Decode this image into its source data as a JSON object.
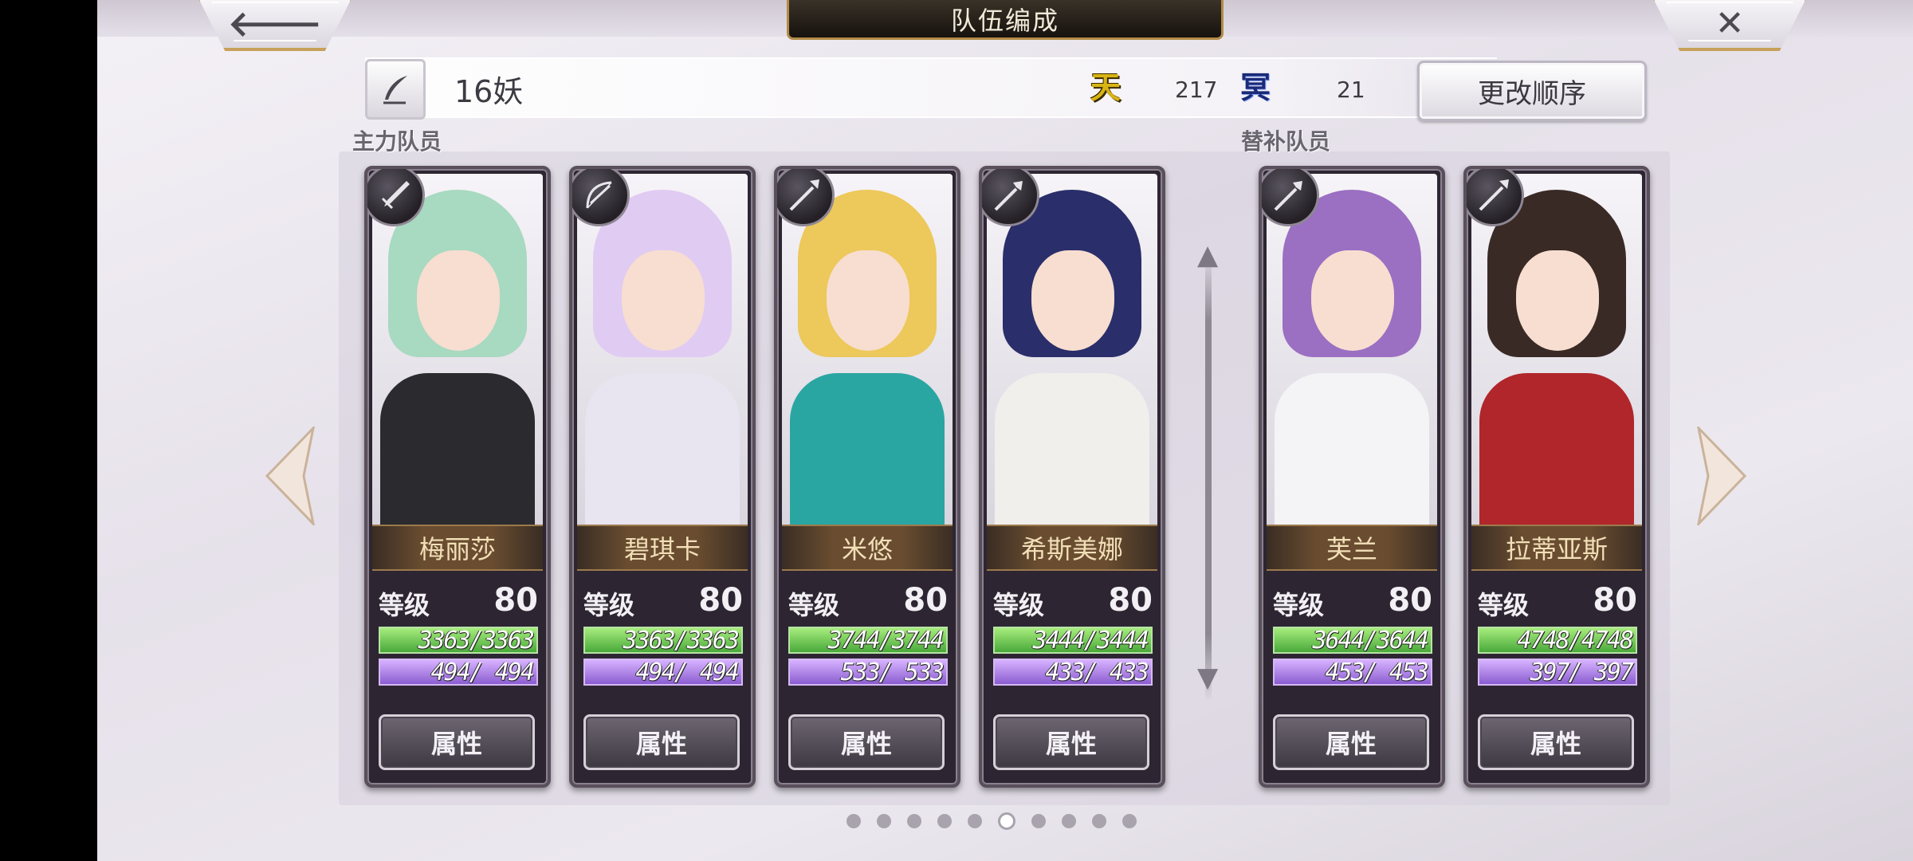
{
  "header": {
    "title": "队伍编成",
    "back_icon": "arrow-left-icon",
    "close_icon": "close-icon"
  },
  "team": {
    "name": "16妖",
    "tian_icon_text": "天",
    "tian_value": "217",
    "ming_icon_text": "冥",
    "ming_value": "21",
    "reorder_label": "更改顺序"
  },
  "sections": {
    "main_label": "主力队员",
    "sub_label": "替补队员"
  },
  "colors": {
    "gold_accent": "#c7a15a",
    "hp_green": "#49a93a",
    "mp_purple": "#8a5dd0",
    "name_text": "#f2dfb8"
  },
  "members": [
    {
      "name": "梅丽莎",
      "level_label": "等级",
      "level": "80",
      "hp": "3363/3363",
      "mp": " 494/ 494",
      "hp_ratio": 1,
      "mp_ratio": 1,
      "button": "属性",
      "weapon": "sword-icon",
      "hair": "#a8d9c1",
      "body": "#2b2b2f"
    },
    {
      "name": "碧琪卡",
      "level_label": "等级",
      "level": "80",
      "hp": "3363/3363",
      "mp": " 494/ 494",
      "hp_ratio": 1,
      "mp_ratio": 1,
      "button": "属性",
      "weapon": "bow-icon",
      "hair": "#e0cbf3",
      "body": "#e8e4f0"
    },
    {
      "name": "米悠",
      "level_label": "等级",
      "level": "80",
      "hp": "3744/3744",
      "mp": " 533/ 533",
      "hp_ratio": 1,
      "mp_ratio": 1,
      "button": "属性",
      "weapon": "spear-icon",
      "hair": "#edc85a",
      "body": "#2aa6a2"
    },
    {
      "name": "希斯美娜",
      "level_label": "等级",
      "level": "80",
      "hp": "3444/3444",
      "mp": " 433/ 433",
      "hp_ratio": 1,
      "mp_ratio": 1,
      "button": "属性",
      "weapon": "staff-icon",
      "hair": "#2a2e6a",
      "body": "#f0efec"
    },
    {
      "name": "芙兰",
      "level_label": "等级",
      "level": "80",
      "hp": "3644/3644",
      "mp": " 453/ 453",
      "hp_ratio": 1,
      "mp_ratio": 1,
      "button": "属性",
      "weapon": "staff-icon",
      "hair": "#9b6fc2",
      "body": "#f4f4f6"
    },
    {
      "name": "拉蒂亚斯",
      "level_label": "等级",
      "level": "80",
      "hp": "4748/4748",
      "mp": " 397/ 397",
      "hp_ratio": 1,
      "mp_ratio": 1,
      "button": "属性",
      "weapon": "spear-icon",
      "hair": "#3a2a26",
      "body": "#b0262b"
    }
  ],
  "pagination": {
    "total": 10,
    "current": 6
  }
}
